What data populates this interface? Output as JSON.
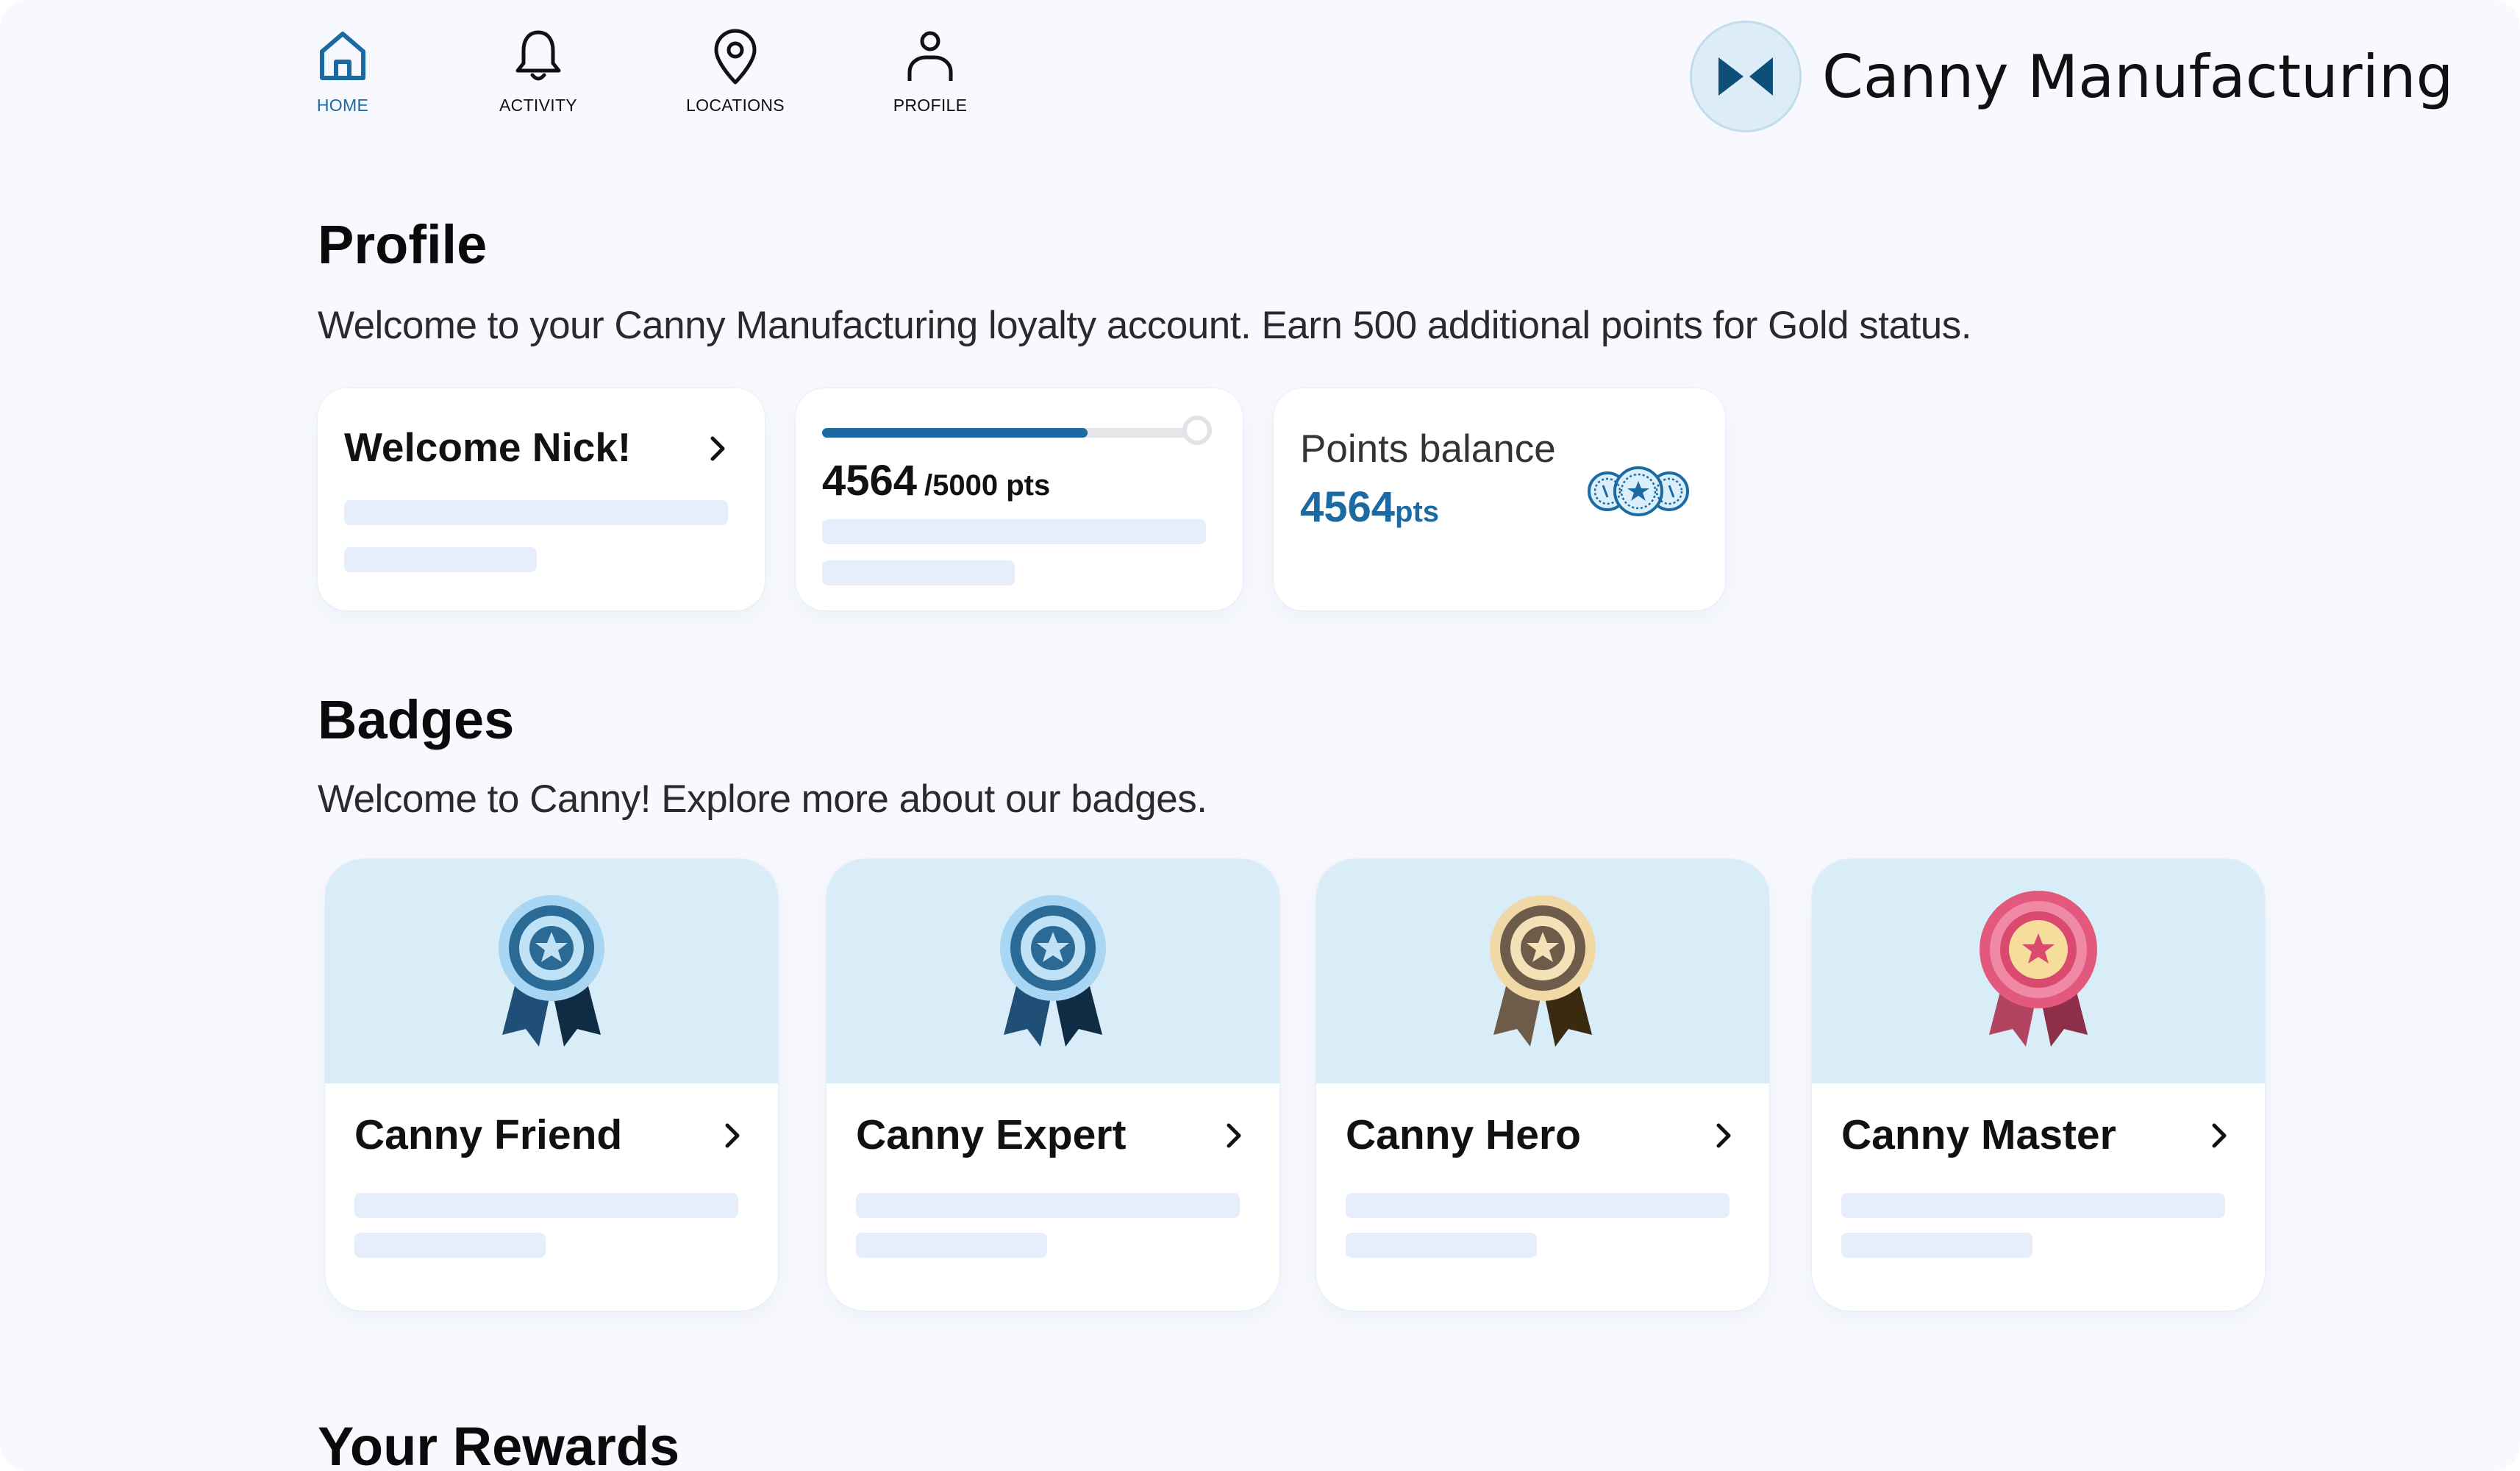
{
  "nav": {
    "items": [
      {
        "label": "HOME",
        "icon": "home-icon",
        "active": true
      },
      {
        "label": "ACTIVITY",
        "icon": "bell-icon",
        "active": false
      },
      {
        "label": "LOCATIONS",
        "icon": "map-pin-icon",
        "active": false
      },
      {
        "label": "PROFILE",
        "icon": "user-icon",
        "active": false
      }
    ]
  },
  "brand": {
    "name": "Canny Manufacturing",
    "logo_icon": "bowtie-logo-icon"
  },
  "profile": {
    "title": "Profile",
    "subtitle": "Welcome to your Canny Manufacturing loyalty account. Earn 500 additional points for Gold status.",
    "welcome_card": {
      "title": "Welcome Nick!"
    },
    "progress_card": {
      "current": "4564",
      "target": "/5000 pts",
      "progress_fraction": 0.9128
    },
    "balance_card": {
      "label": "Points balance",
      "value": "4564",
      "unit": "pts",
      "icon": "coins-icon"
    }
  },
  "badges": {
    "title": "Badges",
    "subtitle": "Welcome to Canny! Explore more about our badges.",
    "items": [
      {
        "name": "Canny Friend",
        "icon": "blue-ribbon-badge-icon"
      },
      {
        "name": "Canny Expert",
        "icon": "blue-ribbon-badge-icon"
      },
      {
        "name": "Canny Hero",
        "icon": "bronze-ribbon-badge-icon"
      },
      {
        "name": "Canny Master",
        "icon": "pink-rosette-badge-icon"
      }
    ]
  },
  "rewards": {
    "title": "Your Rewards"
  },
  "colors": {
    "accent": "#1b6aa1",
    "background": "#f7f9fe",
    "badge_header": "#d8edf8",
    "skeleton": "#e7eefb"
  }
}
